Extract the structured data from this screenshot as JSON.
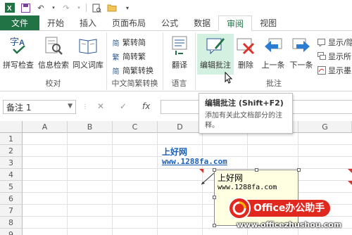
{
  "tabs": {
    "file": "文件",
    "home": "开始",
    "insert": "插入",
    "layout": "页面布局",
    "formulas": "公式",
    "data": "数据",
    "review": "审阅",
    "view": "视图"
  },
  "ribbon": {
    "proofing": {
      "label": "校对",
      "spell": "拼写检查",
      "research": "信息检索",
      "thesaurus": "同义词库"
    },
    "chinese": {
      "label": "中文简繁转换",
      "to_simplified": "繁转简",
      "to_traditional": "简转繁",
      "convert": "简繁转换"
    },
    "language": {
      "label": "语言",
      "translate": "翻译"
    },
    "comments": {
      "label": "批注",
      "edit": "编辑批注",
      "delete": "删除",
      "previous": "上一条",
      "next": "下一条",
      "show_hide": "显示/隐",
      "show_all": "显示所",
      "show_ink": "显示墨"
    }
  },
  "formula_bar": {
    "name_box": "备注 1",
    "cancel": "✕",
    "enter": "✓",
    "fx": "fx"
  },
  "grid": {
    "columns": [
      "A",
      "B",
      "C",
      "D",
      "E",
      "F",
      "G"
    ],
    "rows": [
      "1",
      "2",
      "3",
      "4",
      "5",
      "6",
      "7",
      "8",
      "9"
    ],
    "d2": "上好网",
    "d3": "www.1288fa.com"
  },
  "tooltip": {
    "title": "编辑批注 (Shift+F2)",
    "desc": "添加有关此文档部分的注释。"
  },
  "comment": {
    "author": "上好网",
    "body": "www.1288fa.com"
  },
  "watermark": {
    "brand": "Office办公助手",
    "url": "www.officezhushou.com"
  },
  "colors": {
    "excel_green": "#217346",
    "watermark_red": "#e0281e",
    "link_blue": "#1a5fb4",
    "comment_yellow": "#ffffe1"
  }
}
